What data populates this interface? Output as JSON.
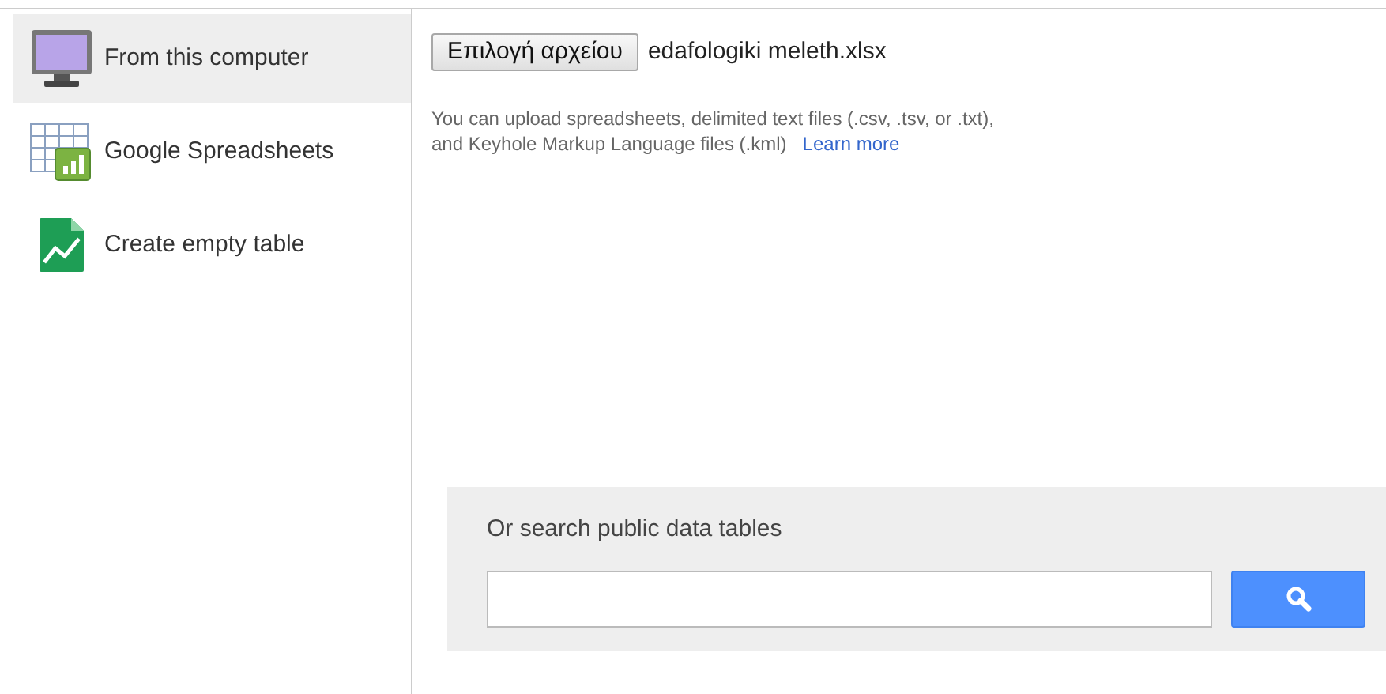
{
  "sidebar": {
    "items": [
      {
        "label": "From this computer",
        "kind": "computer",
        "selected": true
      },
      {
        "label": "Google Spreadsheets",
        "kind": "spreadsheet",
        "selected": false
      },
      {
        "label": "Create empty table",
        "kind": "table",
        "selected": false
      }
    ]
  },
  "upload": {
    "button": "Επιλογή αρχείου",
    "file_name": "edafologiki meleth.xlsx",
    "help_lines": [
      "You can upload spreadsheets, delimited text files (.csv, .tsv, or .txt),",
      "and Keyhole Markup Language files (.kml)"
    ],
    "learn_more": "Learn more"
  },
  "search": {
    "title": "Or search public data tables"
  }
}
